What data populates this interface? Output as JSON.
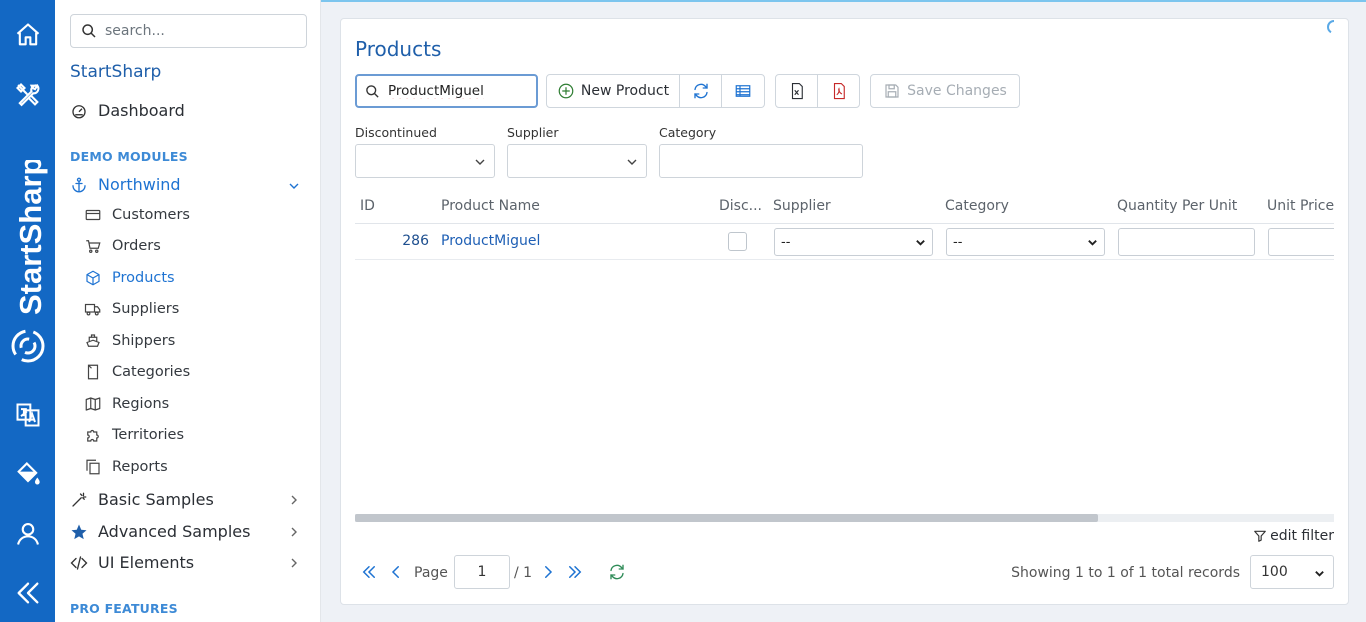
{
  "rail": {
    "brand_text": "StartSharp",
    "icons": [
      "home-icon",
      "tools-icon",
      "translate-icon",
      "paint-bucket-icon",
      "user-icon",
      "collapse-icon"
    ]
  },
  "sidebar": {
    "search_placeholder": "search...",
    "title": "StartSharp",
    "dashboard": "Dashboard",
    "section_demo": "DEMO MODULES",
    "northwind": "Northwind",
    "items": [
      {
        "label": "Customers",
        "icon": "credit-card-icon"
      },
      {
        "label": "Orders",
        "icon": "cart-icon"
      },
      {
        "label": "Products",
        "icon": "box-icon"
      },
      {
        "label": "Suppliers",
        "icon": "truck-icon"
      },
      {
        "label": "Shippers",
        "icon": "ship-icon"
      },
      {
        "label": "Categories",
        "icon": "bookmark-icon"
      },
      {
        "label": "Regions",
        "icon": "map-icon"
      },
      {
        "label": "Territories",
        "icon": "puzzle-icon"
      },
      {
        "label": "Reports",
        "icon": "copy-icon"
      }
    ],
    "basic_samples": "Basic Samples",
    "advanced_samples": "Advanced Samples",
    "ui_elements": "UI Elements",
    "section_pro": "PRO FEATURES"
  },
  "main": {
    "title": "Products",
    "search_value": "ProductMiguel",
    "toolbar": {
      "new_product": "New Product",
      "save_changes": "Save Changes"
    },
    "filters": {
      "discontinued_label": "Discontinued",
      "supplier_label": "Supplier",
      "category_label": "Category"
    },
    "grid": {
      "columns": [
        "ID",
        "Product Name",
        "Disc...",
        "Supplier",
        "Category",
        "Quantity Per Unit",
        "Unit Price"
      ],
      "rows": [
        {
          "id": "286",
          "name": "ProductMiguel",
          "supplier": "--",
          "category": "--"
        }
      ]
    },
    "edit_filter": "edit filter",
    "pager": {
      "page_word": "Page",
      "page_value": "1",
      "page_total": "/ 1",
      "showing": "Showing 1 to 1 of 1 total records",
      "page_size": "100"
    }
  },
  "colors": {
    "rail": "#1368c4",
    "accent": "#1f5faa",
    "link": "#1e73d2",
    "section": "#3d8ad6"
  }
}
